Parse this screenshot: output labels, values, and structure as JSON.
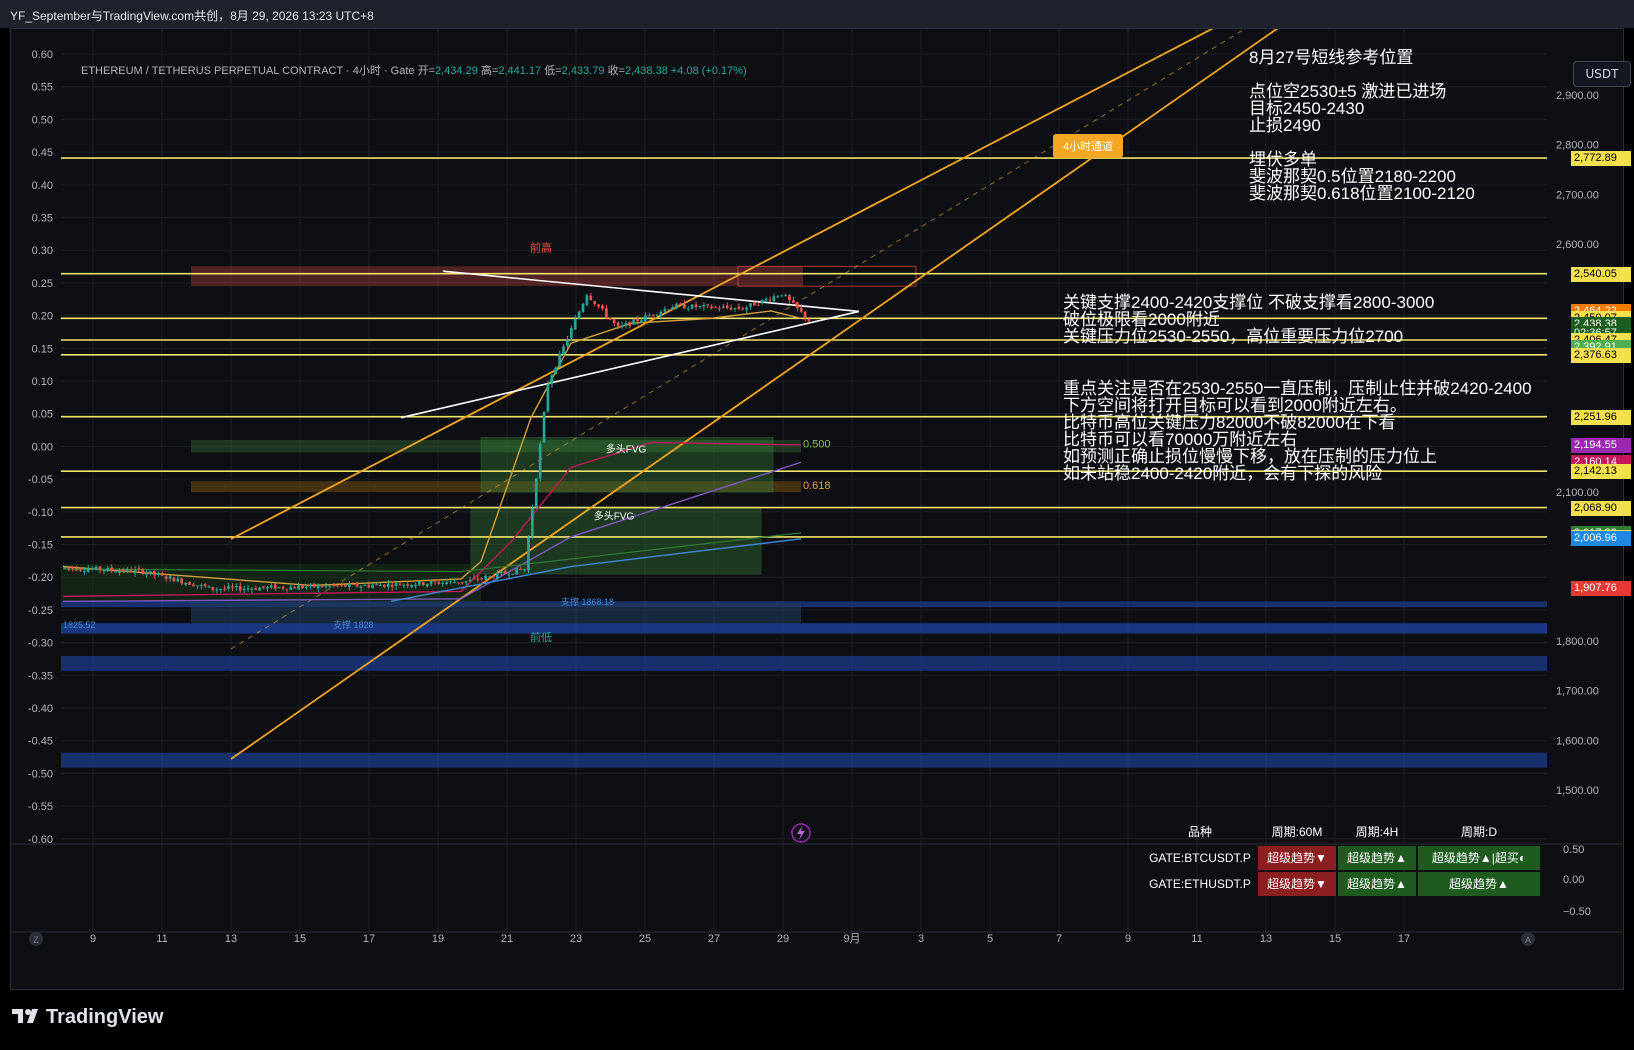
{
  "window": {
    "title": "YF_September与TradingView.com共创，8月 29, 2026 13:23 UTC+8"
  },
  "header": {
    "symbol_line": "ETHEREUM / TETHERUS PERPETUAL CONTRACT · 4小时 · Gate",
    "open_label": "开=",
    "open": "2,434.29",
    "high_label": "高=",
    "high": "2,441.17",
    "low_label": "低=",
    "low": "2,433.79",
    "close_label": "收=",
    "close": "2,438.38",
    "change": "+4.08 (+0.17%)"
  },
  "currency_button": "USDT",
  "brand": "TradingView",
  "colors": {
    "bg": "#0e0f13",
    "grid": "#1c1f27",
    "channel": "#f5a623",
    "level": "#f0e36a",
    "up": "#26a69a",
    "down": "#ef5350",
    "bull": "#22bb33",
    "bear": "#ff4444"
  },
  "chart_data": {
    "type": "candlestick",
    "symbol": "ETHUSDT.P",
    "timeframe": "4小时",
    "price_axis": {
      "min": 1450,
      "max": 3010,
      "ticks": [
        "2,900.00",
        "2,800.00",
        "2,700.00",
        "2,600.00",
        "2,100.00",
        "1,800.00",
        "1,700.00",
        "1,600.00",
        "1,500.00"
      ],
      "tick_values": [
        2900,
        2800,
        2700,
        2600,
        2100,
        1800,
        1700,
        1600,
        1500
      ]
    },
    "left_axis": {
      "ticks": [
        "0.60",
        "0.55",
        "0.50",
        "0.45",
        "0.40",
        "0.35",
        "0.30",
        "0.25",
        "0.20",
        "0.15",
        "0.10",
        "0.05",
        "0.00",
        "-0.05",
        "-0.10",
        "-0.15",
        "-0.20",
        "-0.25",
        "-0.30",
        "-0.35",
        "-0.40",
        "-0.45",
        "-0.50",
        "-0.55",
        "-0.60"
      ]
    },
    "x_axis": {
      "labels": [
        "9",
        "11",
        "13",
        "15",
        "17",
        "19",
        "21",
        "23",
        "25",
        "27",
        "29",
        "9月",
        "3",
        "5",
        "7",
        "9",
        "11",
        "13",
        "15",
        "17"
      ]
    },
    "oscillator_axis": {
      "ticks": [
        "0.50",
        "0.00",
        "−0.50"
      ]
    },
    "level_lines": [
      2772.89,
      2540.05,
      2450.07,
      2406.47,
      2376.63,
      2251.96,
      2142.13,
      2068.9,
      2009.74
    ],
    "price_labels": [
      {
        "text": "2,772.89",
        "value": 2772.89,
        "bg": "#f3e04e",
        "fg": "#000"
      },
      {
        "text": "2,540.05",
        "value": 2540.05,
        "bg": "#f3e04e",
        "fg": "#000"
      },
      {
        "text": "2,464.22",
        "value": 2464.22,
        "bg": "#f57c00",
        "fg": "#fff"
      },
      {
        "text": "2,450.07",
        "value": 2450.07,
        "bg": "#f3e04e",
        "fg": "#000"
      },
      {
        "text": "2,438.38",
        "value": 2438.38,
        "bg": "#1b5e20",
        "fg": "#fff"
      },
      {
        "text": "02:36:57",
        "value": 2420,
        "bg": "#1b5e20",
        "fg": "#fff"
      },
      {
        "text": "2,406.47",
        "value": 2406.47,
        "bg": "#f3e04e",
        "fg": "#000"
      },
      {
        "text": "2,392.91",
        "value": 2392.91,
        "bg": "#4caf50",
        "fg": "#fff"
      },
      {
        "text": "2,376.63",
        "value": 2376.63,
        "bg": "#f3e04e",
        "fg": "#000"
      },
      {
        "text": "2,251.96",
        "value": 2251.96,
        "bg": "#f3e04e",
        "fg": "#000"
      },
      {
        "text": "2,194.55",
        "value": 2194.55,
        "bg": "#9c27b0",
        "fg": "#fff"
      },
      {
        "text": "2,160.14",
        "value": 2160.14,
        "bg": "#c2185b",
        "fg": "#fff"
      },
      {
        "text": "2,142.13",
        "value": 2142.13,
        "bg": "#f3e04e",
        "fg": "#000"
      },
      {
        "text": "2,068.90",
        "value": 2068.9,
        "bg": "#f3e04e",
        "fg": "#000"
      },
      {
        "text": "2,017.83",
        "value": 2017.83,
        "bg": "#2e7d32",
        "fg": "#fff"
      },
      {
        "text": "2,009.74",
        "value": 2009.74,
        "bg": "#f3e04e",
        "fg": "#000"
      },
      {
        "text": "2,006.96",
        "value": 2006.96,
        "bg": "#1e88e5",
        "fg": "#fff"
      },
      {
        "text": "1,907.76",
        "value": 1907.76,
        "bg": "#e53935",
        "fg": "#fff"
      }
    ],
    "chart_labels": {
      "prev_high": "前高",
      "prev_low": "前低",
      "fvg1": "多头FVG",
      "fvg2": "多头FVG",
      "fib_0500": "0.500",
      "fib_0618": "0.618",
      "channel": "4小时通道",
      "support_a": "支撑 1868.18",
      "support_b": "支撑 1828",
      "left_price": "1825.52"
    }
  },
  "annotations": {
    "plan": [
      "8月27号短线参考位置",
      "",
      "点位空2530±5  激进已进场",
      "目标2450-2430",
      "止损2490",
      "",
      "埋伏多单",
      "斐波那契0.5位置2180-2200",
      "斐波那契0.618位置2100-2120"
    ],
    "support": [
      "关键支撑2400-2420支撑位 不破支撑看2800-3000",
      "破位极限看2000附近",
      "关键压力位2530-2550，高位重要压力位2700"
    ],
    "focus": [
      "重点关注是否在2530-2550一直压制，压制止住并破2420-2400",
      "下方空间将打开目标可以看到2000附近左右。",
      "比特币高位关键压力82000不破82000在下看",
      "比特币可以看70000万附近左右",
      "如预测正确止损位慢慢下移，放在压制的压力位上",
      "如未站稳2400-2420附近，会有下探的风险"
    ]
  },
  "trend_table": {
    "headers": [
      "品种",
      "周期:60M",
      "周期:4H",
      "周期:D"
    ],
    "rows": [
      {
        "symbol": "GATE:BTCUSDT.P",
        "m60": "超级趋势▼",
        "h4": "超级趋势▲",
        "d": "超级趋势▲|超买◐"
      },
      {
        "symbol": "GATE:ETHUSDT.P",
        "m60": "超级趋势▼",
        "h4": "超级趋势▲",
        "d": "超级趋势▲"
      }
    ]
  }
}
